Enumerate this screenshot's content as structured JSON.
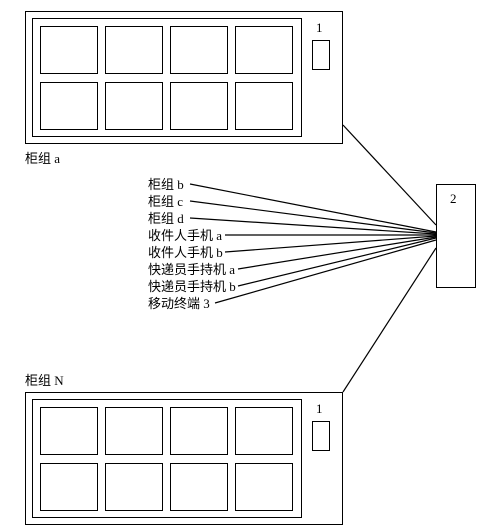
{
  "cabinets": {
    "top": {
      "label": "柜组 a",
      "tag": "1"
    },
    "bottom": {
      "label": "柜组 N",
      "tag": "1"
    }
  },
  "server": {
    "tag": "2"
  },
  "middle_labels": [
    "柜组 b",
    "柜组 c",
    "柜组 d",
    "收件人手机 a",
    "收件人手机 b",
    "快递员手持机 a",
    "快递员手持机 b",
    "移动终端 3"
  ]
}
